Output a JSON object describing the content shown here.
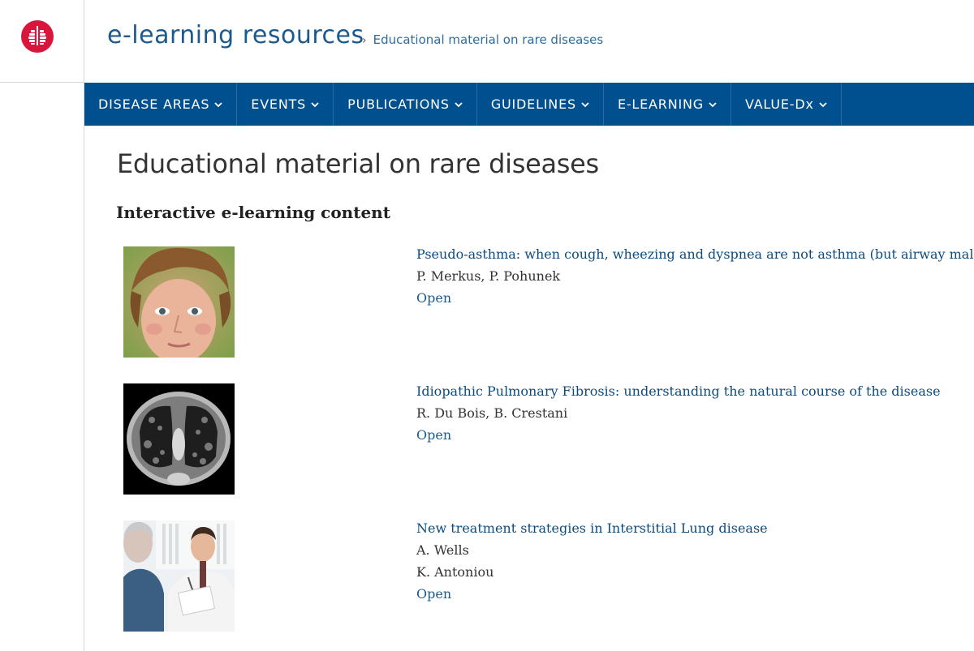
{
  "header": {
    "site_title": "e-learning resources",
    "breadcrumb_sep": "›",
    "breadcrumb": "Educational material on rare diseases",
    "brand_color": "#d8163c"
  },
  "nav": {
    "items": [
      {
        "label": "DISEASE AREAS"
      },
      {
        "label": "EVENTS"
      },
      {
        "label": "PUBLICATIONS"
      },
      {
        "label": "GUIDELINES"
      },
      {
        "label": "E-LEARNING"
      },
      {
        "label": "VALUE-Dx"
      }
    ],
    "bg_color": "#00508f"
  },
  "main": {
    "page_title": "Educational material on rare diseases",
    "section_title": "Interactive e-learning content",
    "items": [
      {
        "title": "Pseudo-asthma: when cough, wheezing and dyspnea are not asthma (but airway malacia)",
        "authors": [
          "P. Merkus, P. Pohunek"
        ],
        "link": "Open",
        "image": "child-portrait"
      },
      {
        "title": "Idiopathic Pulmonary Fibrosis: understanding the natural course of the disease",
        "authors": [
          "R. Du Bois, B. Crestani"
        ],
        "link": "Open",
        "image": "lung-ct-scan"
      },
      {
        "title": "New treatment strategies in Interstitial Lung disease",
        "authors": [
          "A. Wells",
          "K. Antoniou"
        ],
        "link": "Open",
        "image": "doctor-patient"
      }
    ]
  }
}
